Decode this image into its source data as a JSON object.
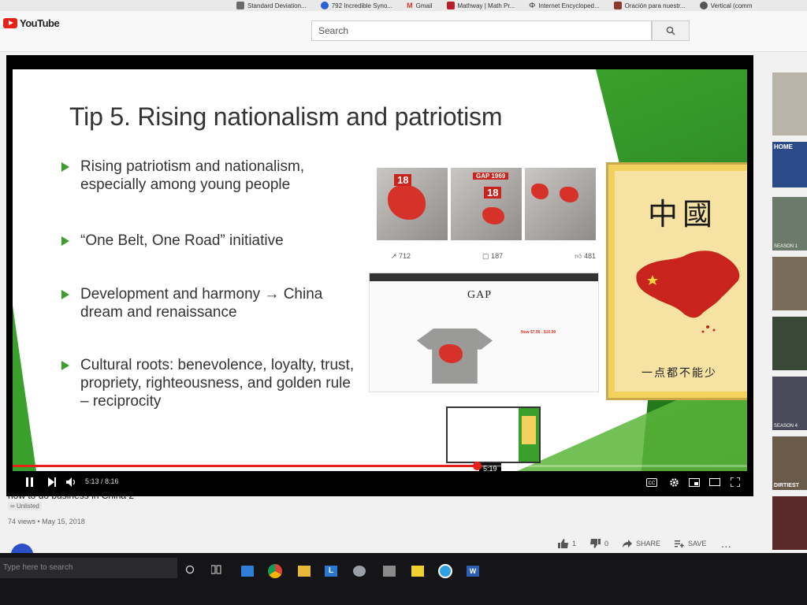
{
  "bookmarks": [
    {
      "label": "Standard Deviation...",
      "color": "#6a6a6a"
    },
    {
      "label": "792 Incredible Syno...",
      "color": "#2962d8"
    },
    {
      "label": "Gmail",
      "color": "#d33b2c"
    },
    {
      "label": "Mathway | Math Pr...",
      "color": "#b81f28"
    },
    {
      "label": "Internet Encycloped...",
      "color": "#222222"
    },
    {
      "label": "Oración para nuestr...",
      "color": "#8a3a2c"
    },
    {
      "label": "Vertical (comm",
      "color": "#555555"
    }
  ],
  "header": {
    "logo": "YouTube",
    "search_placeholder": "Search"
  },
  "slide": {
    "title": "Tip 5. Rising nationalism and patriotism",
    "bullets": [
      "Rising patriotism and nationalism, especially among young people",
      "“One Belt, One Road” initiative",
      "Development and harmony → China dream and renaissance",
      "Cultural roots: benevolence, loyalty, trust, propriety, righteousness, and golden rule – reciprocity"
    ],
    "photo_labels": [
      "18",
      "GAP 1969",
      "18"
    ],
    "stats": {
      "shares": "712",
      "comments": "187",
      "likes": "481"
    },
    "gap_logo": "GAP",
    "gap_price": "Now $7.99 - $10.99",
    "poster_title": "中國",
    "poster_bottom": "一点都不能少"
  },
  "player": {
    "thumbnail_time": "5:19",
    "time_display": "5:13 / 8:16",
    "progress_fraction": 0.632
  },
  "video": {
    "title": "how to do business in China 2",
    "unlisted": "Unlisted",
    "meta": "74 views • May 15, 2018",
    "likes": "1",
    "dislikes": "0",
    "share": "SHARE",
    "save": "SAVE"
  },
  "sidebar": {
    "labels": [
      "HOME",
      "SEASON 1",
      "SEASON 4",
      "DIRTIEST"
    ]
  },
  "taskbar": {
    "search_placeholder": "Type here to search"
  },
  "colors": {
    "youtube_red": "#e62117",
    "slide_green": "#3aa02c",
    "map_red": "#d6322a"
  }
}
